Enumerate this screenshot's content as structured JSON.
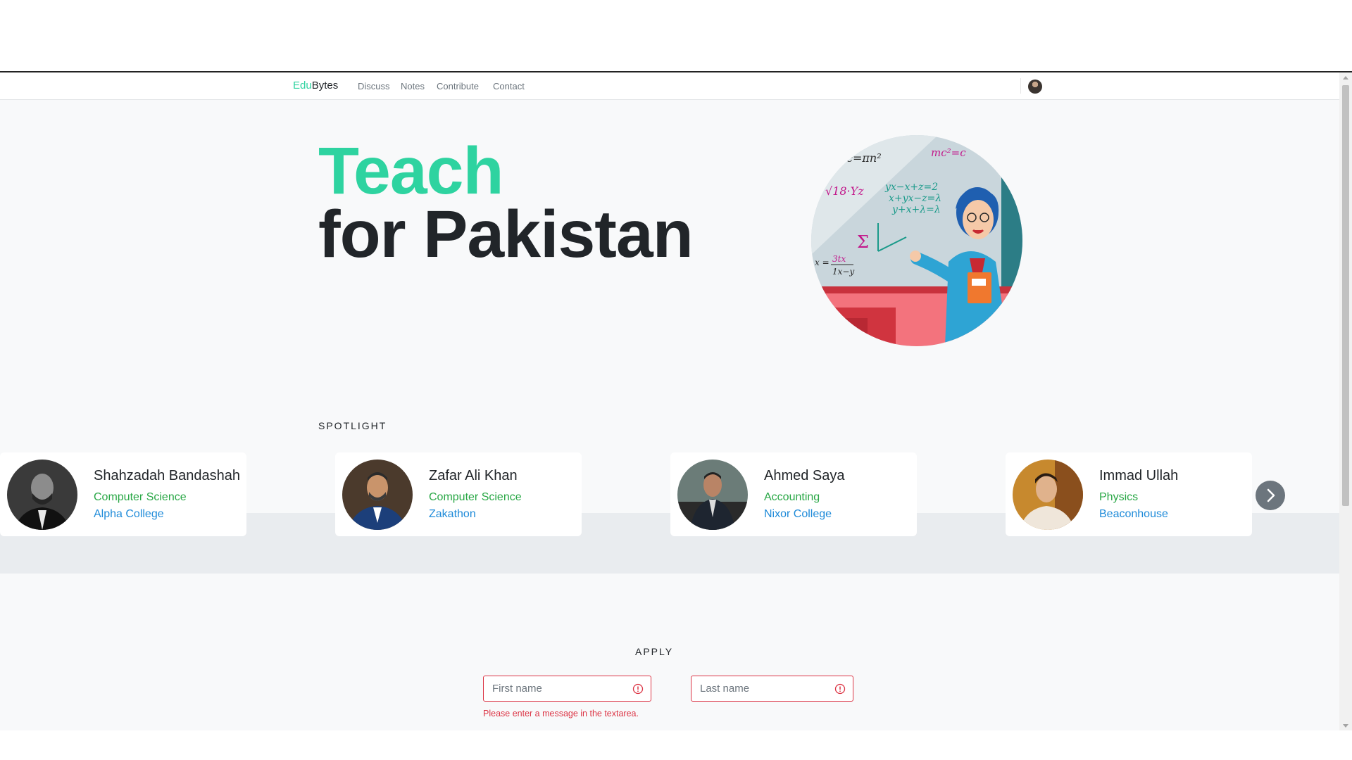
{
  "nav": {
    "brand_part1": "Edu",
    "brand_part2": "Bytes",
    "links": [
      "Discuss",
      "Notes",
      "Contribute",
      "Contact"
    ]
  },
  "hero": {
    "line1": "Teach",
    "line2": "for Pakistan",
    "image_icon": "teacher-illustration"
  },
  "spotlight": {
    "heading": "SPOTLIGHT",
    "cards": [
      {
        "name": "Shahzadah Bandashah",
        "subject": "Computer Science",
        "school": "Alpha College"
      },
      {
        "name": "Zafar Ali Khan",
        "subject": "Computer Science",
        "school": "Zakathon"
      },
      {
        "name": "Ahmed Saya",
        "subject": "Accounting",
        "school": "Nixor College"
      },
      {
        "name": "Immad Ullah",
        "subject": "Physics",
        "school": "Beaconhouse"
      }
    ],
    "next_icon": "chevron-right-icon"
  },
  "apply": {
    "heading": "APPLY",
    "first_name_placeholder": "First name",
    "last_name_placeholder": "Last name",
    "error": "Please enter a message in the textarea."
  },
  "colors": {
    "accent": "#2ed3a0",
    "subject": "#28a745",
    "school": "#1f8bd9",
    "error": "#dc3545"
  }
}
